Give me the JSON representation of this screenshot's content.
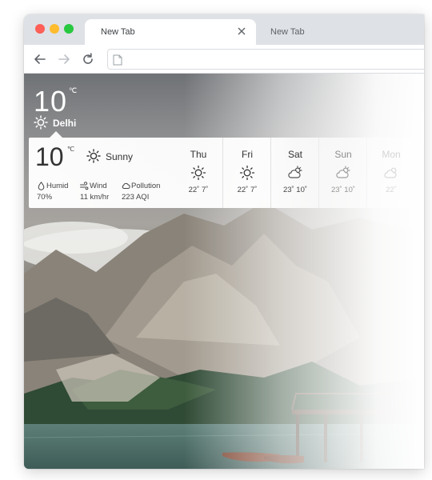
{
  "browser": {
    "tabs": [
      {
        "title": "New Tab",
        "active": true
      },
      {
        "title": "New Tab",
        "active": false
      }
    ]
  },
  "weather": {
    "current": {
      "temp": "10",
      "unit": "℃",
      "city": "Delhi",
      "condition": "Sunny",
      "icon": "sun-icon"
    },
    "stats": {
      "humid": {
        "label": "Humid",
        "value": "70%"
      },
      "wind": {
        "label": "Wind",
        "value": "11 km/hr"
      },
      "pollution": {
        "label": "Pollution",
        "value": "223 AQI"
      }
    },
    "forecast": [
      {
        "day": "Thu",
        "icon": "sun-icon",
        "temps": "22˚ 7˚"
      },
      {
        "day": "Fri",
        "icon": "sun-icon",
        "temps": "22˚ 7˚"
      },
      {
        "day": "Sat",
        "icon": "partly-cloudy-icon",
        "temps": "23˚ 10˚"
      },
      {
        "day": "Sun",
        "icon": "partly-cloudy-icon",
        "temps": "23˚ 10˚"
      },
      {
        "day": "Mon",
        "icon": "partly-cloudy-icon",
        "temps": "22˚"
      }
    ]
  },
  "colors": {
    "close_red": "#fe5f57",
    "minimize_yellow": "#febc2e",
    "maximize_green": "#28c840"
  }
}
